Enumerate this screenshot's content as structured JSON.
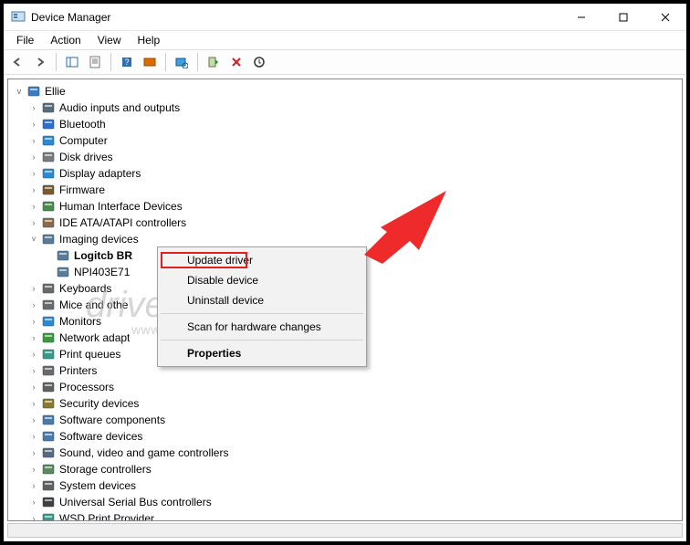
{
  "window": {
    "title": "Device Manager",
    "controls": {
      "min": "—",
      "max": "▢",
      "close": "✕"
    }
  },
  "menu": [
    "File",
    "Action",
    "View",
    "Help"
  ],
  "toolbar_icons": [
    "back-icon",
    "forward-icon",
    "sep",
    "show-hide-tree-icon",
    "properties-page-icon",
    "sep",
    "help-icon",
    "action-icon",
    "sep",
    "scan-hardware-icon",
    "sep",
    "enable-icon",
    "disable-icon",
    "uninstall-icon"
  ],
  "tree": {
    "root": "Ellie",
    "categories": [
      {
        "label": "Audio inputs and outputs",
        "icon": "audio-icon"
      },
      {
        "label": "Bluetooth",
        "icon": "bluetooth-icon"
      },
      {
        "label": "Computer",
        "icon": "computer-icon"
      },
      {
        "label": "Disk drives",
        "icon": "disk-icon"
      },
      {
        "label": "Display adapters",
        "icon": "display-icon"
      },
      {
        "label": "Firmware",
        "icon": "firmware-icon"
      },
      {
        "label": "Human Interface Devices",
        "icon": "hid-icon"
      },
      {
        "label": "IDE ATA/ATAPI controllers",
        "icon": "ide-icon"
      },
      {
        "label": "Imaging devices",
        "icon": "imaging-icon",
        "expanded": true,
        "children": [
          {
            "label": "Logitcb BR",
            "icon": "camera-icon",
            "selected": true
          },
          {
            "label": "NPI403E71",
            "icon": "camera-icon"
          }
        ]
      },
      {
        "label": "Keyboards",
        "icon": "keyboard-icon"
      },
      {
        "label": "Mice and othe",
        "icon": "mouse-icon"
      },
      {
        "label": "Monitors",
        "icon": "monitor-icon"
      },
      {
        "label": "Network adapt",
        "icon": "network-icon"
      },
      {
        "label": "Print queues",
        "icon": "printer-icon"
      },
      {
        "label": "Printers",
        "icon": "printer2-icon"
      },
      {
        "label": "Processors",
        "icon": "cpu-icon"
      },
      {
        "label": "Security devices",
        "icon": "security-icon"
      },
      {
        "label": "Software components",
        "icon": "software-icon"
      },
      {
        "label": "Software devices",
        "icon": "software2-icon"
      },
      {
        "label": "Sound, video and game controllers",
        "icon": "sound-icon"
      },
      {
        "label": "Storage controllers",
        "icon": "storage-icon"
      },
      {
        "label": "System devices",
        "icon": "system-icon"
      },
      {
        "label": "Universal Serial Bus controllers",
        "icon": "usb-icon"
      },
      {
        "label": "WSD Print Provider",
        "icon": "wsd-icon"
      }
    ]
  },
  "context_menu": {
    "items": [
      {
        "label": "Update driver",
        "highlight": true
      },
      {
        "label": "Disable device"
      },
      {
        "label": "Uninstall device"
      },
      {
        "sep": true
      },
      {
        "label": "Scan for hardware changes"
      },
      {
        "sep": true
      },
      {
        "label": "Properties",
        "bold": true
      }
    ]
  },
  "watermark": {
    "main": "driver easy",
    "sub": "www.DriverEasy.com"
  }
}
